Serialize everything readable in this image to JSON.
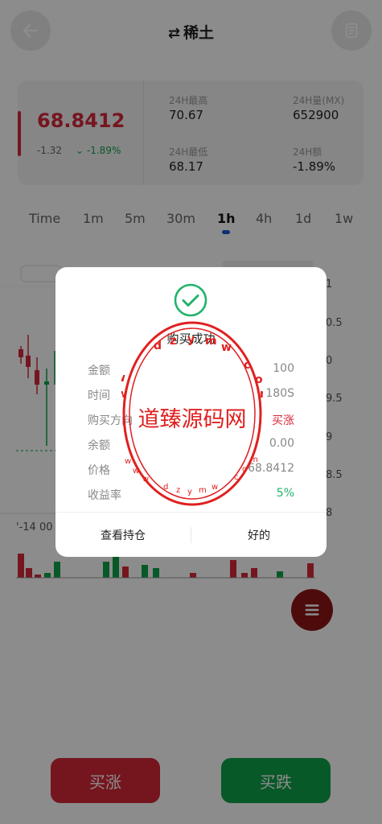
{
  "header": {
    "title": "稀土",
    "swap_symbol": "⇄"
  },
  "ticker": {
    "price": "68.8412",
    "change": "-1.32",
    "change_pct": "-1.89%",
    "high_label": "24H最高",
    "high": "70.67",
    "low_label": "24H最低",
    "low": "68.17",
    "vol_label": "24H量(MX)",
    "vol": "652900",
    "amt_label": "24H额",
    "amt": "-1.89%"
  },
  "intervals": [
    "Time",
    "1m",
    "5m",
    "30m",
    "1h",
    "4h",
    "1d",
    "1w"
  ],
  "active_interval": "1h",
  "chart": {
    "axis_values": [
      "1",
      "0.5",
      "0",
      "9.5",
      "9",
      "8.5",
      "8"
    ],
    "time_label": "'-14 00"
  },
  "modal": {
    "title": "购买成功",
    "rows": [
      {
        "key": "金额",
        "value": "100"
      },
      {
        "key": "时间",
        "value": "180S"
      },
      {
        "key": "购买方向",
        "value": "买涨"
      },
      {
        "key": "余额",
        "value": "0.00"
      },
      {
        "key": "价格",
        "value": "68.8412"
      },
      {
        "key": "收益率",
        "value": "5%"
      }
    ],
    "view_position": "查看持仓",
    "ok": "好的"
  },
  "watermark": {
    "text": "道臻源码网",
    "ring": "w w w . d z y m w . c o m"
  },
  "actions": {
    "buy_up": "买涨",
    "buy_down": "买跌"
  },
  "colors": {
    "up": "#d6283a",
    "down": "#10a34a",
    "accent": "#1d57d8",
    "success": "#21b36a"
  }
}
